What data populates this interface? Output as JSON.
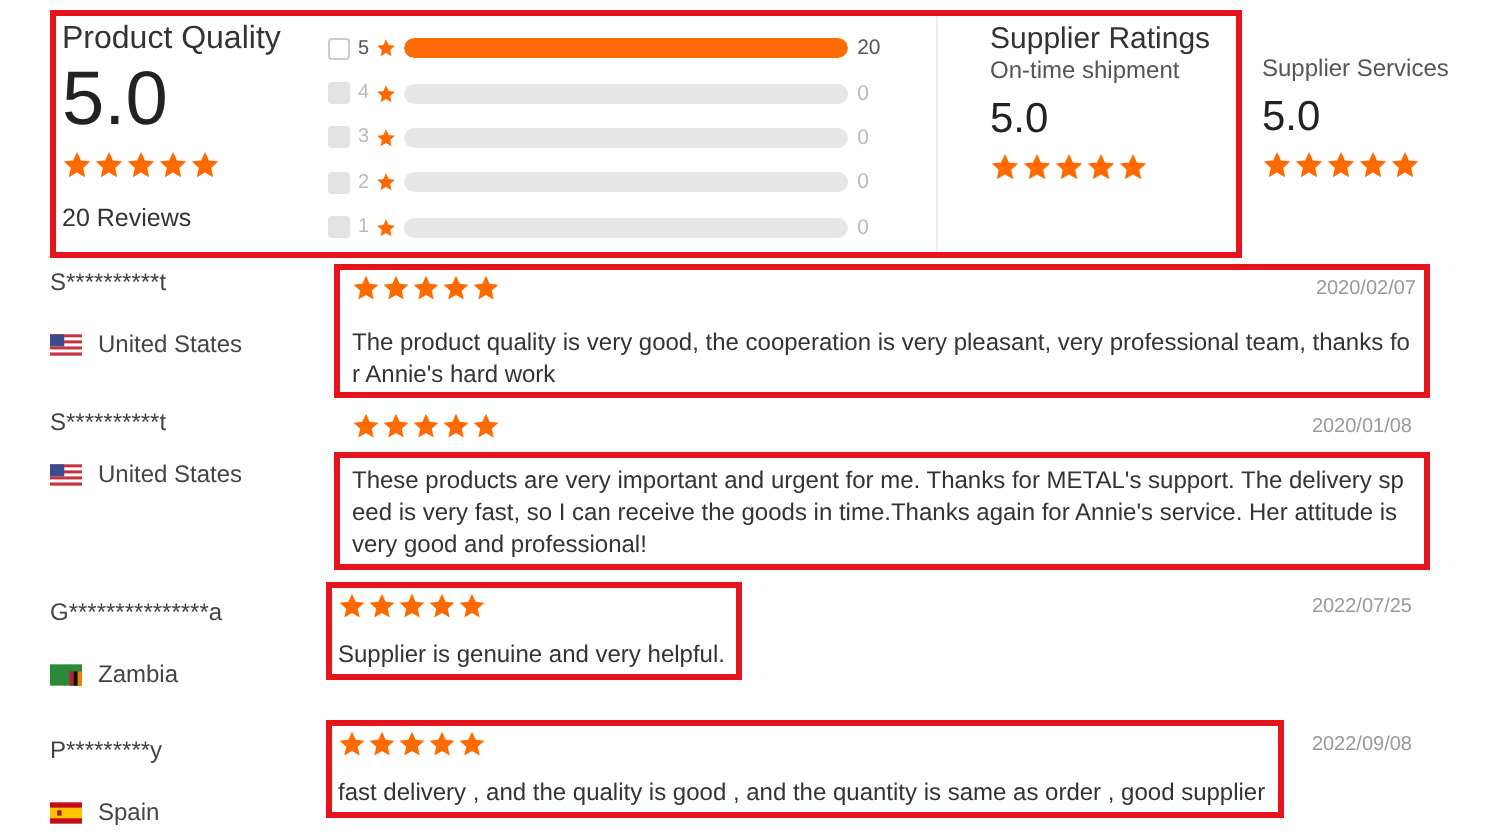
{
  "summary": {
    "annotated": true,
    "product_quality": {
      "title": "Product Quality",
      "score": "5.0",
      "stars": 5,
      "reviews": "20 Reviews"
    },
    "breakdown": [
      {
        "rating": "5",
        "count": "20",
        "level": 1,
        "disabled": false
      },
      {
        "rating": "4",
        "count": "0",
        "level": 0,
        "disabled": true
      },
      {
        "rating": "3",
        "count": "0",
        "level": 0,
        "disabled": true
      },
      {
        "rating": "2",
        "count": "0",
        "level": 0,
        "disabled": true
      },
      {
        "rating": "1",
        "count": "0",
        "level": 0,
        "disabled": true
      }
    ],
    "supplier_ratings": {
      "title": "Supplier Ratings",
      "label": "On-time shipment",
      "score": "5.0",
      "stars": 5
    }
  },
  "supplier_services": {
    "label": "Supplier Services",
    "score": "5.0",
    "stars": 5
  },
  "reviews": [
    {
      "kind": "whole",
      "name": "S**********t",
      "flag": {
        "kind": "us"
      },
      "country": "United States",
      "stars": 5,
      "date": "2020/02/07",
      "text": "The product quality is very good, the cooperation is very pleasant, very professional team, thanks for Annie's hard work"
    },
    {
      "kind": "text",
      "name": "S**********t",
      "flag": {
        "kind": "us"
      },
      "country": "United States",
      "stars": 5,
      "date": "2020/01/08",
      "text": "These products are very important and urgent for me. Thanks for METAL's support. The delivery speed is very fast, so I can receive the goods in time.Thanks again for Annie's service. Her attitude is very good and professional!"
    },
    {
      "kind": "stars_and_text",
      "name": "G***************a",
      "flag": {
        "kind": "zm"
      },
      "country": "Zambia",
      "stars": 5,
      "date": "2022/07/25",
      "text": "Supplier is genuine and very helpful."
    },
    {
      "kind": "stars_and_text",
      "name": "P*********y",
      "flag": {
        "kind": "es"
      },
      "country": "Spain",
      "stars": 5,
      "date": "2022/09/08",
      "text": "fast delivery , and the quality is good , and the quantity is same as order , good supplier"
    }
  ]
}
